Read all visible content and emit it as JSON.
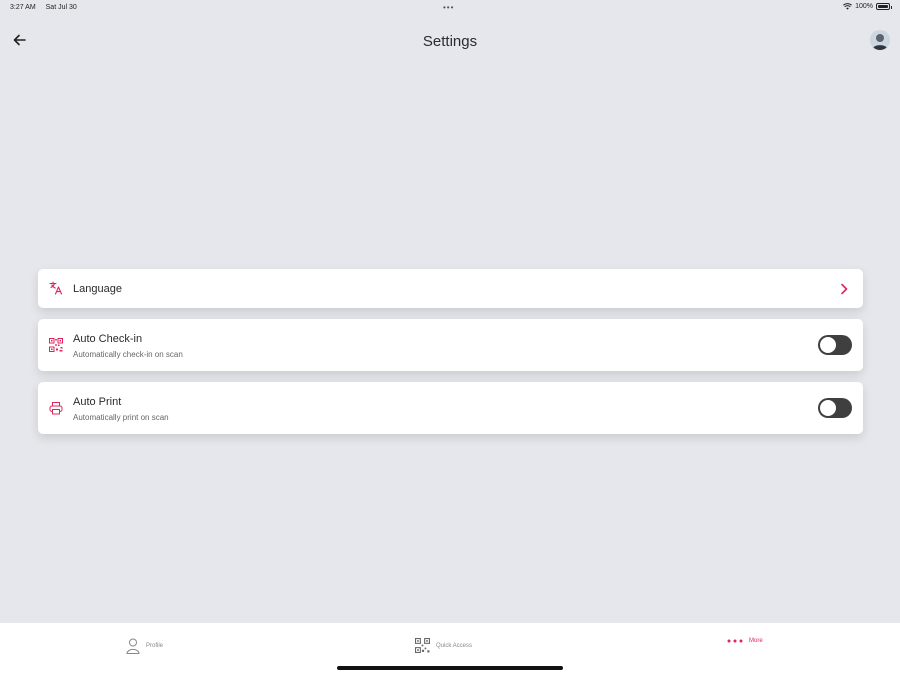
{
  "status": {
    "time": "3:27 AM",
    "date": "Sat Jul 30",
    "battery": "100%",
    "battery_level": 1.0
  },
  "header": {
    "title": "Settings"
  },
  "settings": {
    "language": {
      "title": "Language"
    },
    "auto_checkin": {
      "title": "Auto Check-in",
      "subtitle": "Automatically check-in on scan",
      "enabled": false
    },
    "auto_print": {
      "title": "Auto Print",
      "subtitle": "Automatically print on scan",
      "enabled": false
    }
  },
  "tabbar": {
    "profile": "Profile",
    "quick_access": "Quick Access",
    "more": "More"
  },
  "colors": {
    "accent": "#e0245e",
    "background": "#e6e7ec",
    "toggle_off": "#3f3f3f"
  }
}
